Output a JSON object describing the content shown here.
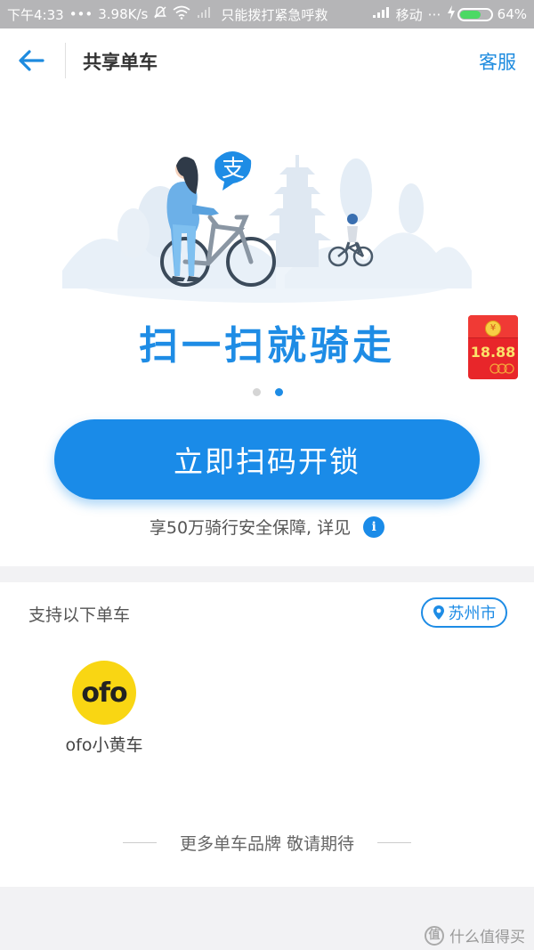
{
  "status_bar": {
    "time": "下午4:33",
    "dots": "•••",
    "speed": "3.98K/s",
    "emergency": "只能拨打紧急呼救",
    "carrier": "移动",
    "battery": "64%",
    "battery_level": 0.64
  },
  "nav": {
    "title": "共享单车",
    "service": "客服"
  },
  "hero": {
    "slogan": "扫一扫就骑走",
    "red_packet_amount": "18.88",
    "scan_button": "立即扫码开锁",
    "insurance_text": "享50万骑行安全保障, 详见",
    "info_icon": "i",
    "pagination": {
      "total": 2,
      "active_index": 1
    }
  },
  "brands": {
    "title": "支持以下单车",
    "city": "苏州市",
    "items": [
      {
        "logo_text": "ofo",
        "name": "ofo小黄车"
      }
    ],
    "more": "更多单车品牌 敬请期待"
  },
  "watermark": {
    "logo": "值",
    "text": "什么值得买"
  },
  "colors": {
    "accent": "#1a8be8",
    "ofo_yellow": "#f9d613",
    "red_packet": "#e8262a"
  }
}
